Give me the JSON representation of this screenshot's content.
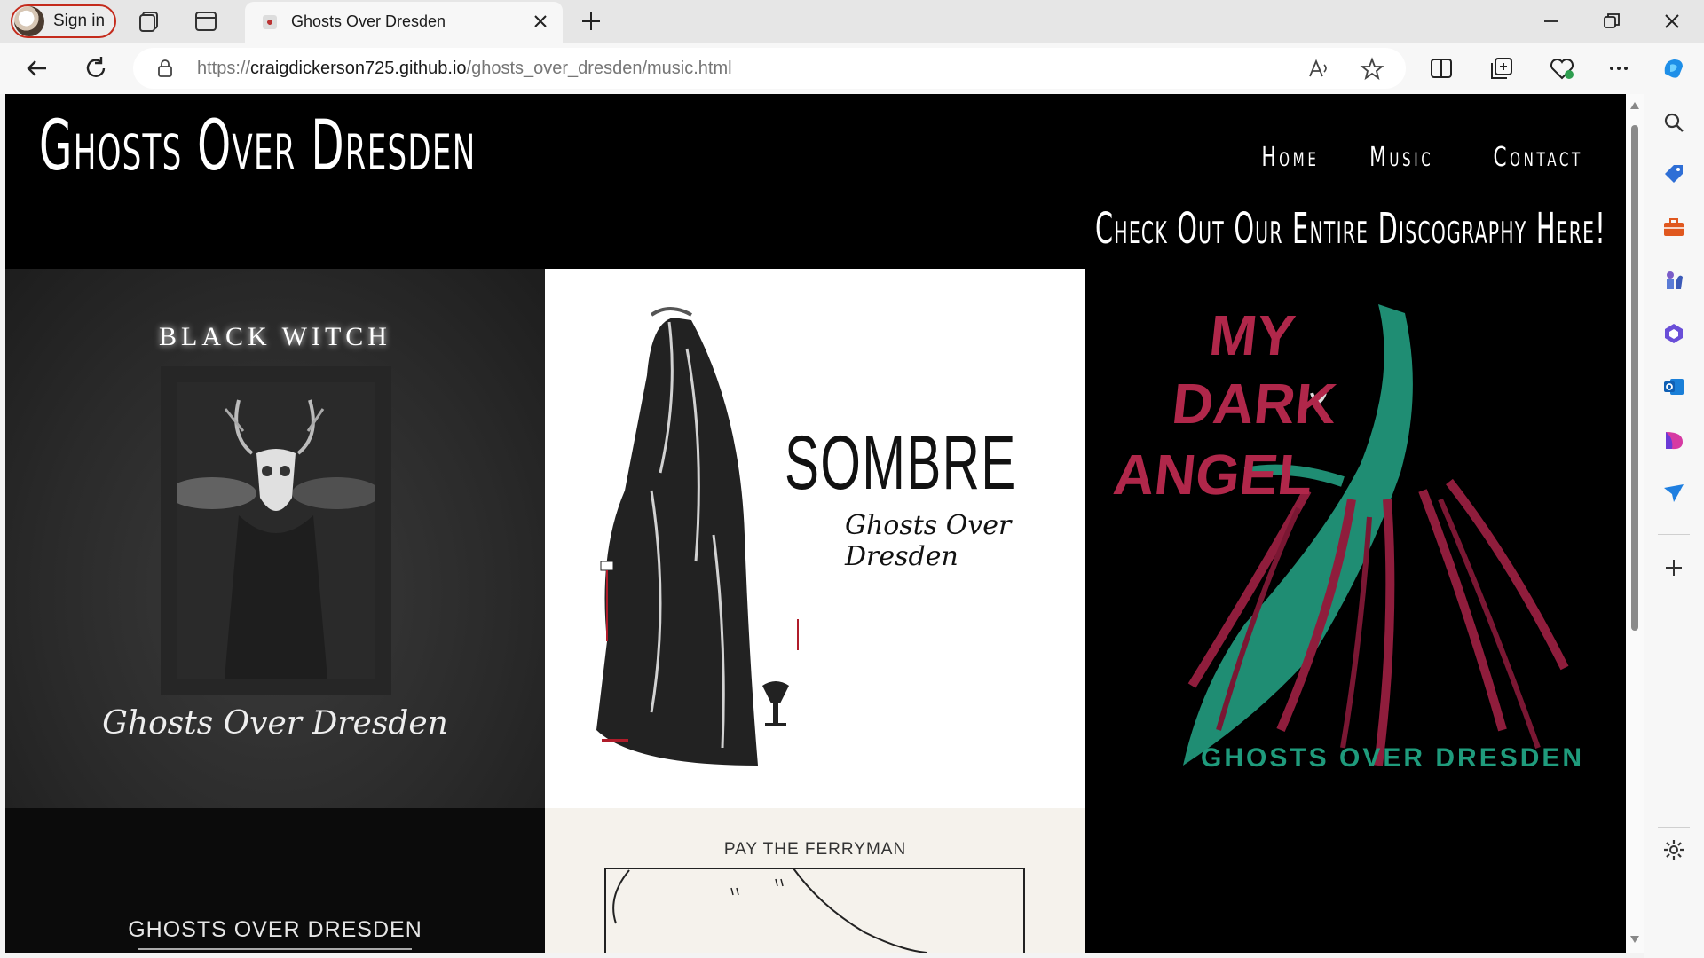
{
  "browser": {
    "signin_label": "Sign in",
    "tab_title": "Ghosts Over Dresden",
    "url_prefix": "https://",
    "url_host": "craigdickerson725.github.io",
    "url_path": "/ghosts_over_dresden/music.html",
    "accent": "#c42b1c"
  },
  "site": {
    "title": "Ghosts Over Dresden",
    "nav": [
      "Home",
      "Music",
      "Contact"
    ],
    "tagline": "Check Out Our Entire Discography Here!"
  },
  "albums": {
    "black_witch_title": "BLACK WITCH",
    "black_witch_band": "Ghosts Over Dresden",
    "sombre_title": "SOMBRE",
    "sombre_band": "Ghosts Over Dresden",
    "dark_angel_title": [
      "MY",
      "DARK",
      "ANGEL"
    ],
    "dark_angel_band": "GHOSTS OVER DRESDEN",
    "album4_band": "GHOSTS OVER DRESDEN",
    "album5_title": "PAY THE FERRYMAN"
  }
}
